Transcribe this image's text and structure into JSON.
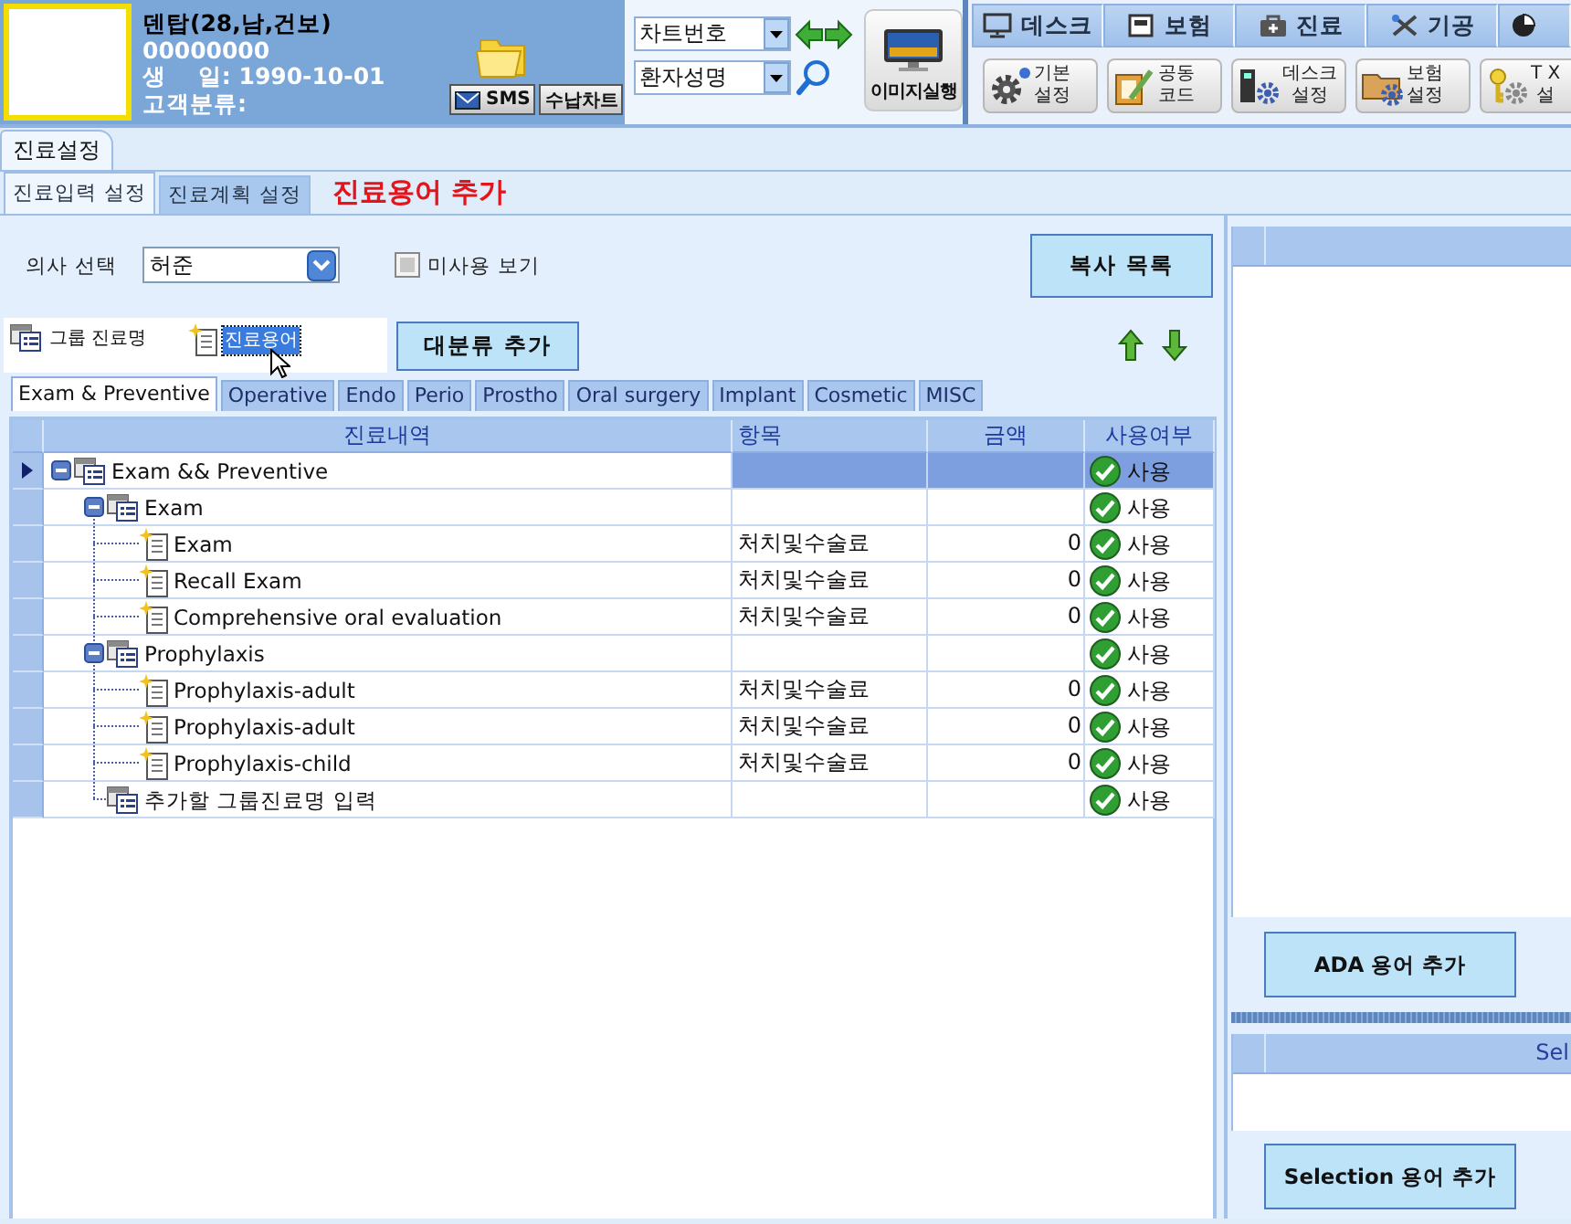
{
  "patient": {
    "name": "덴탑(28,남,건보)",
    "chart_no": "00000000",
    "birthdate": "생    일: 1990-10-01",
    "customer_class": "고객분류:"
  },
  "header_buttons": [
    {
      "label": "SMS",
      "kind": "sms"
    },
    {
      "label": "수납차트",
      "kind": "receipt"
    }
  ],
  "search": {
    "fields": [
      {
        "value": "차트번호"
      },
      {
        "value": "환자성명"
      }
    ],
    "image_button": "이미지실행"
  },
  "nav_tabs": [
    {
      "label": "데스크",
      "kind": "desk",
      "selected": false
    },
    {
      "label": "보험",
      "kind": "insurance",
      "selected": false
    },
    {
      "label": "진료",
      "kind": "treatment",
      "selected": false
    },
    {
      "label": "기공",
      "kind": "lab",
      "selected": false
    },
    {
      "kind": "stats",
      "selected": false
    }
  ],
  "toolbar": [
    {
      "label": "기본\n설정",
      "kind": "basic"
    },
    {
      "label": "공동\n코드",
      "kind": "code"
    },
    {
      "label": "데스크\n설정",
      "kind": "desk"
    },
    {
      "label": "보험\n설정",
      "kind": "insurance"
    },
    {
      "label": "T X\n설",
      "kind": "tx"
    }
  ],
  "page_tabs": [
    {
      "label": "진료설정",
      "selected": true
    }
  ],
  "sub_tabs": [
    {
      "label": "진료입력 설정",
      "selected": true
    },
    {
      "label": "진료계획 설정",
      "selected": false
    }
  ],
  "title": "진료용어 추가",
  "doctor": {
    "label": "의사 선택",
    "value": "허준"
  },
  "show_unused": {
    "label": "미사용 보기",
    "checked": false
  },
  "copy_button": "복사 목록",
  "legend": [
    {
      "label": "그룹 진료명",
      "kind": "group",
      "selected": false
    },
    {
      "label": "진료용어",
      "kind": "term",
      "selected": true
    }
  ],
  "add_category_button": "대분류 추가",
  "category_tabs": [
    {
      "label": "Exam & Preventive",
      "selected": true
    },
    {
      "label": "Operative",
      "selected": false
    },
    {
      "label": "Endo",
      "selected": false
    },
    {
      "label": "Perio",
      "selected": false
    },
    {
      "label": "Prostho",
      "selected": false
    },
    {
      "label": "Oral surgery",
      "selected": false
    },
    {
      "label": "Implant",
      "selected": false
    },
    {
      "label": "Cosmetic",
      "selected": false
    },
    {
      "label": "MISC",
      "selected": false
    }
  ],
  "table": {
    "columns": [
      "진료내역",
      "항목",
      "금액",
      "사용여부"
    ],
    "rows": [
      {
        "name": "Exam && Preventive",
        "kind": "group",
        "expanded": true,
        "selected": true,
        "usage": "사용",
        "children": [
          {
            "name": "Exam",
            "kind": "group",
            "expanded": true,
            "selected": false,
            "usage": "사용",
            "children": [
              {
                "name": "Exam",
                "kind": "term",
                "selected": false,
                "category": "처치및수술료",
                "amount": "0",
                "usage": "사용"
              },
              {
                "name": "Recall Exam",
                "kind": "term",
                "selected": false,
                "category": "처치및수술료",
                "amount": "0",
                "usage": "사용"
              },
              {
                "name": "Comprehensive oral evaluation",
                "kind": "term",
                "selected": false,
                "category": "처치및수술료",
                "amount": "0",
                "usage": "사용"
              }
            ]
          },
          {
            "name": "Prophylaxis",
            "kind": "group",
            "expanded": true,
            "selected": false,
            "usage": "사용",
            "children": [
              {
                "name": "Prophylaxis-adult",
                "kind": "term",
                "selected": false,
                "category": "처치및수술료",
                "amount": "0",
                "usage": "사용"
              },
              {
                "name": "Prophylaxis-adult",
                "kind": "term",
                "selected": false,
                "category": "처치및수술료",
                "amount": "0",
                "usage": "사용"
              },
              {
                "name": "Prophylaxis-child",
                "kind": "term",
                "selected": false,
                "category": "처치및수술료",
                "amount": "0",
                "usage": "사용"
              }
            ]
          },
          {
            "name": "추가할 그룹진료명 입력",
            "kind": "add-row",
            "selected": false,
            "usage": "사용"
          }
        ]
      }
    ]
  },
  "right_panel": {
    "ada_button": "ADA 용어 추가",
    "selection_grid": {
      "columns": [
        "Sel"
      ]
    },
    "selection_button": "Selection 용어 추가"
  }
}
